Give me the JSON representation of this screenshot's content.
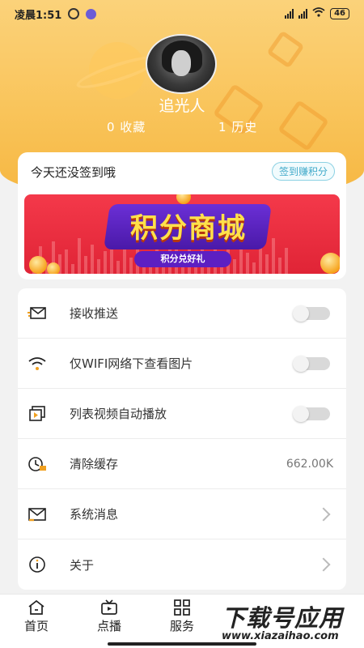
{
  "status_bar": {
    "time": "凌晨1:51",
    "network": "4G",
    "battery": "46"
  },
  "profile": {
    "username": "追光人",
    "favorites": "0 收藏",
    "history": "1 历史"
  },
  "sign_in": {
    "prompt": "今天还没签到哦",
    "button_label": "签到赚积分"
  },
  "banner": {
    "title": "积分商城",
    "subtitle": "积分兑好礼"
  },
  "settings": [
    {
      "label": "接收推送",
      "control": "toggle",
      "value": false,
      "icon": "message-icon"
    },
    {
      "label": "仅WIFI网络下查看图片",
      "control": "toggle",
      "value": false,
      "icon": "wifi-icon"
    },
    {
      "label": "列表视频自动播放",
      "control": "toggle",
      "value": false,
      "icon": "video-play-icon"
    },
    {
      "label": "清除缓存",
      "control": "value",
      "value": "662.00K",
      "icon": "clock-clear-icon"
    },
    {
      "label": "系统消息",
      "control": "chevron",
      "icon": "mail-icon"
    },
    {
      "label": "关于",
      "control": "chevron",
      "icon": "info-icon"
    }
  ],
  "tabbar": {
    "items": [
      {
        "label": "首页",
        "icon": "home-icon"
      },
      {
        "label": "点播",
        "icon": "tv-icon"
      },
      {
        "label": "服务",
        "icon": "grid-icon"
      },
      {
        "label": "",
        "icon": "layers-icon"
      }
    ]
  },
  "watermark": {
    "title": "下载号应用",
    "url": "www.xiazaihao.com"
  },
  "colors": {
    "header_top": "#fbd27a",
    "header_bottom": "#f6b640",
    "banner_red": "#e02436",
    "accent_cyan": "#3fa9c9"
  }
}
